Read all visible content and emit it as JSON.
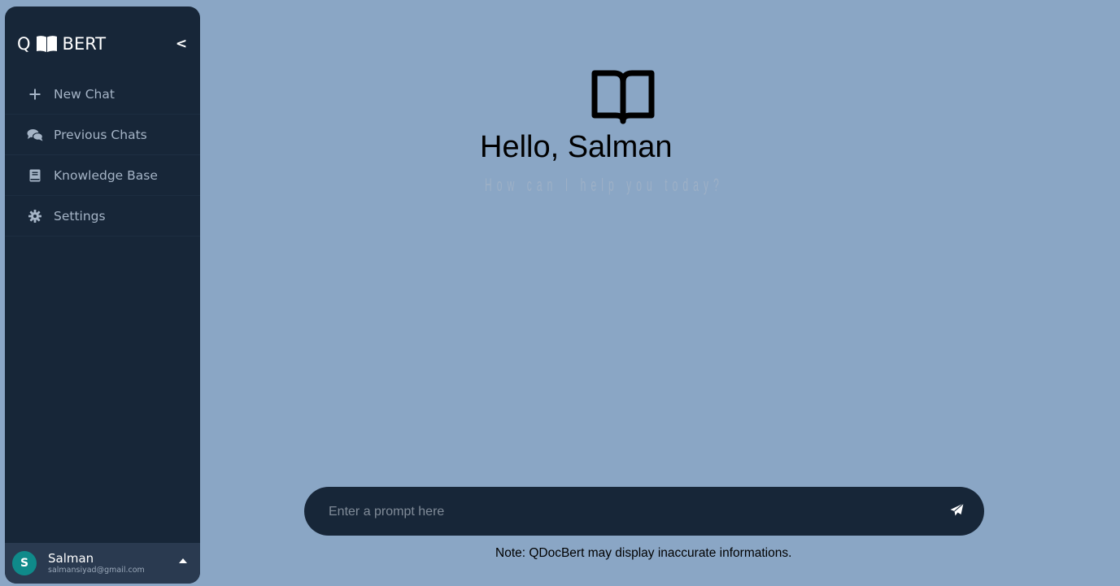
{
  "sidebar": {
    "brand": {
      "prefix": "Q",
      "book_icon": "open-book-icon",
      "suffix": "BERT"
    },
    "collapse_label": "<",
    "items": [
      {
        "label": "New Chat",
        "icon": "plus-icon"
      },
      {
        "label": "Previous Chats",
        "icon": "chat-bubbles-icon"
      },
      {
        "label": "Knowledge Base",
        "icon": "book-icon"
      },
      {
        "label": "Settings",
        "icon": "gear-icon"
      }
    ],
    "user": {
      "initial": "S",
      "name": "Salman",
      "email": "salmansiyad@gmail.com"
    }
  },
  "main": {
    "hero_icon": "open-book-icon",
    "greeting": "Hello, Salman",
    "subtitle": "How can I help you today?",
    "prompt": {
      "placeholder": "Enter a prompt here",
      "value": "",
      "send_icon": "paper-plane-icon"
    },
    "note": "Note: QDocBert may display inaccurate informations."
  },
  "colors": {
    "page_background": "#8aa6c5",
    "sidebar_background": "#172638",
    "user_bar_background": "#2a3a50",
    "avatar_background": "#0f8a8a",
    "nav_text": "#a5b4c6"
  }
}
